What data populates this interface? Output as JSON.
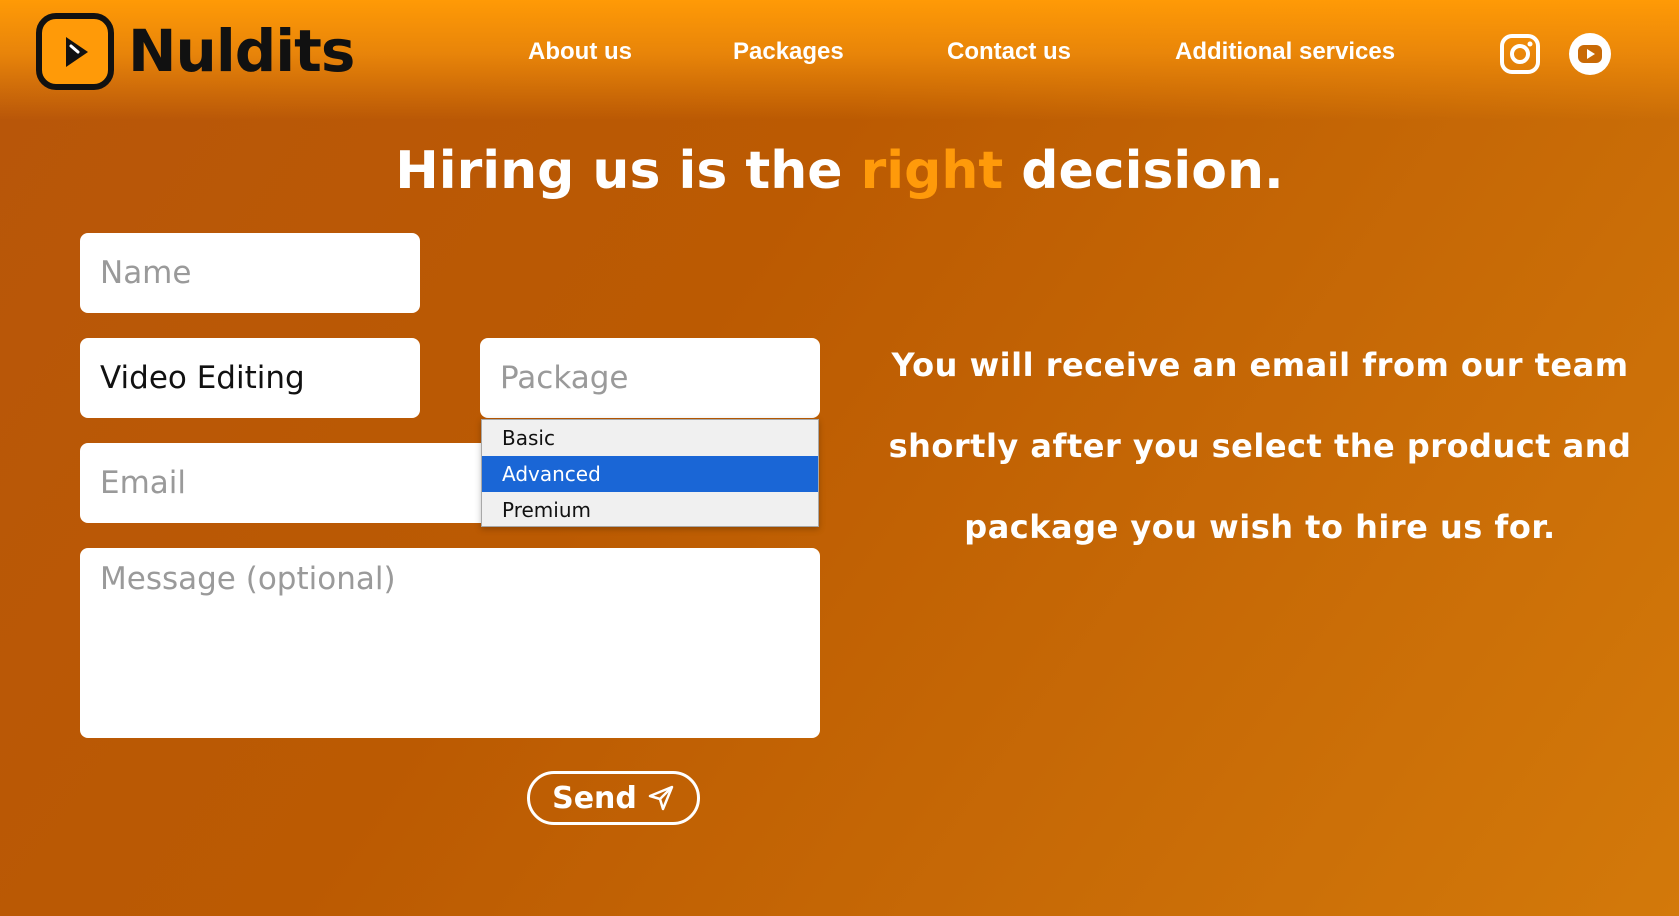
{
  "brand": {
    "name": "Nuldits",
    "logo_icon": "play-icon"
  },
  "nav": {
    "items": [
      {
        "label": "About us"
      },
      {
        "label": "Packages"
      },
      {
        "label": "Contact us"
      },
      {
        "label": "Additional services"
      }
    ],
    "social": [
      {
        "icon": "instagram-icon"
      },
      {
        "icon": "youtube-icon"
      }
    ]
  },
  "headline": {
    "before": "Hiring us is the ",
    "accent": "right",
    "after": " decision."
  },
  "form": {
    "name_placeholder": "Name",
    "product_value": "Video Editing",
    "package_placeholder": "Package",
    "package_options": [
      {
        "label": "Basic",
        "selected": false
      },
      {
        "label": "Advanced",
        "selected": true
      },
      {
        "label": "Premium",
        "selected": false
      }
    ],
    "email_placeholder": "Email",
    "message_placeholder": "Message (optional)",
    "send_label": "Send",
    "send_icon": "send-icon"
  },
  "info": {
    "text": "You will receive an email from our team shortly after you select the product and package you wish to hire us for."
  },
  "colors": {
    "accent": "#ff9a0a",
    "background": "#bb5a02",
    "selected_option": "#1a66d6"
  }
}
